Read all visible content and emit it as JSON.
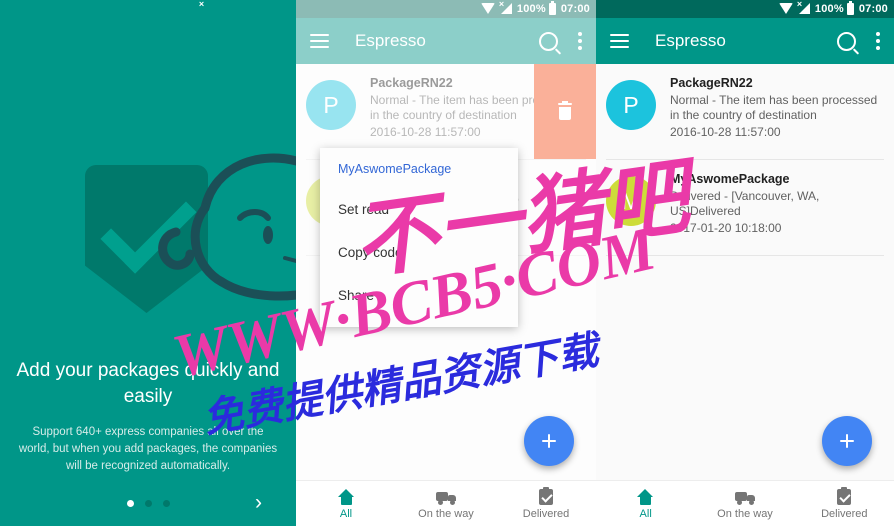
{
  "statusbar": {
    "battery": "100%",
    "time": "07:00",
    "icons": [
      "wifi-icon",
      "signal-icon",
      "battery-icon"
    ]
  },
  "app": {
    "title": "Espresso",
    "menu_icon": "hamburger-icon",
    "search_icon": "search-icon",
    "overflow_icon": "more-vert-icon"
  },
  "onboarding": {
    "logo_icon": "shield-check-icon",
    "title": "Add your packages quickly and easily",
    "subtitle": "Support 640+ express companies all over the world, but when you add packages, the companies will be recognized automatically.",
    "dots": 3,
    "active_dot": 0,
    "next_label": "›"
  },
  "packages": [
    {
      "avatar_letter": "P",
      "avatar_color": "#1cc3dd",
      "title": "PackageRN22",
      "status": "Normal - The item has been processed in the country of destination",
      "date": "2016-10-28 11:57:00"
    },
    {
      "avatar_letter": "M",
      "avatar_color": "#cddc39",
      "title": "MyAswomePackage",
      "status": "Delivered - [Vancouver, WA, US]Delivered",
      "date": "2017-01-20 10:18:00"
    }
  ],
  "swipe_action": {
    "icon": "trash-icon",
    "color": "#f4511e"
  },
  "dialog": {
    "title": "MyAswomePackage",
    "items": [
      "Set read",
      "Copy code",
      "Share"
    ]
  },
  "fab": {
    "icon": "plus-icon",
    "color": "#4285f4"
  },
  "bottom_nav": {
    "items": [
      {
        "label": "All",
        "icon": "home-icon",
        "active": true
      },
      {
        "label": "On the way",
        "icon": "truck-icon",
        "active": false
      },
      {
        "label": "Delivered",
        "icon": "clipboard-check-icon",
        "active": false
      }
    ]
  },
  "watermark": {
    "cn_top": "不一猪吧",
    "url": "WWW·BCB5·COM",
    "cn_bottom": "免费提供精品资源下载",
    "pink": "#ea3aa8",
    "blue": "#2b2bdd"
  },
  "theme": {
    "primary": "#009688",
    "primary_dark": "#00695c",
    "accent": "#4285f4",
    "delete": "#f4511e"
  }
}
